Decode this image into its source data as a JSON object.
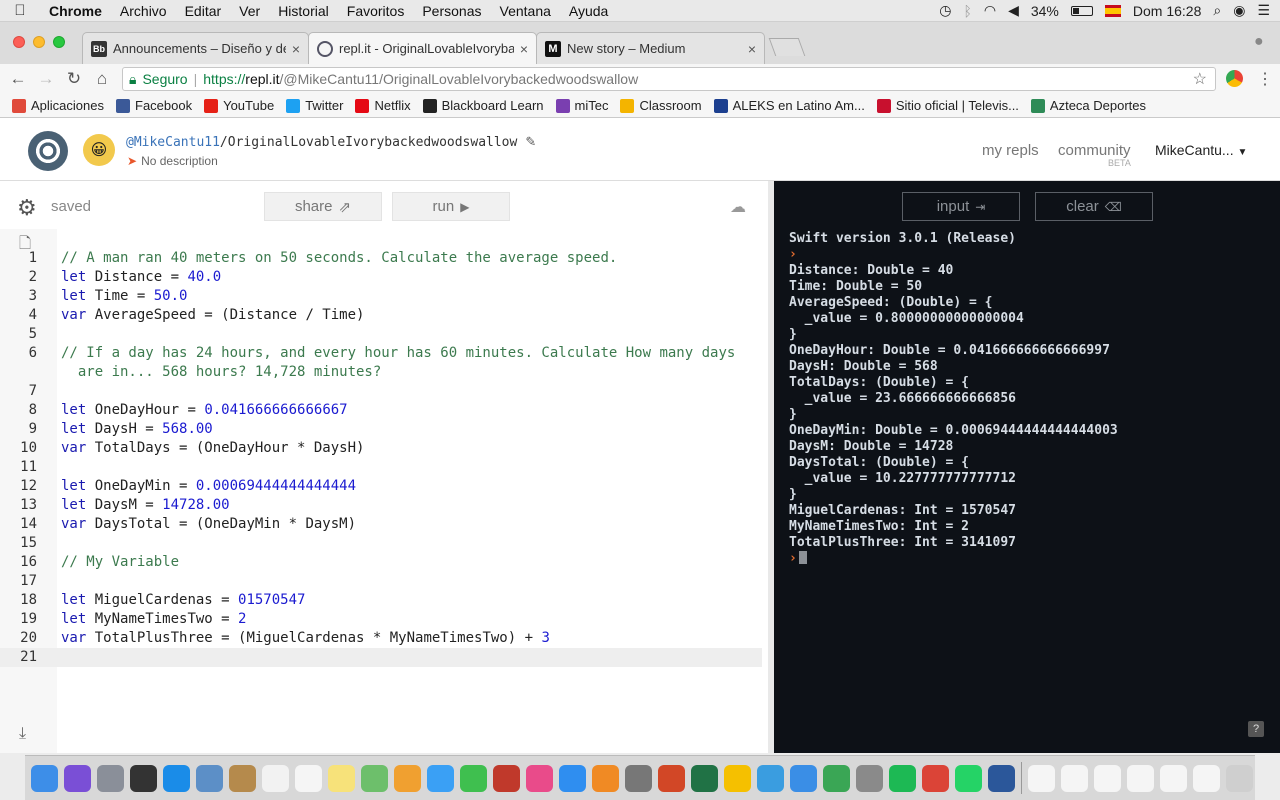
{
  "menubar": {
    "apple": "",
    "app": "Chrome",
    "items": [
      "Archivo",
      "Editar",
      "Ver",
      "Historial",
      "Favoritos",
      "Personas",
      "Ventana",
      "Ayuda"
    ],
    "battery": "34%",
    "clock": "Dom 16:28"
  },
  "tabs": [
    {
      "favicon": "Bb",
      "title": "Announcements – Diseño y de",
      "close": "×"
    },
    {
      "favicon": "",
      "title": "repl.it - OriginalLovableIvoryba",
      "close": "×"
    },
    {
      "favicon": "M",
      "title": "New story – Medium",
      "close": "×"
    }
  ],
  "address": {
    "secure_label": "Seguro",
    "scheme": "https://",
    "host": "repl.it",
    "path": "/@MikeCantu11/OriginalLovableIvorybackedwoodswallow"
  },
  "bookmarks": [
    {
      "label": "Aplicaciones",
      "icon": "apps-grid-icon",
      "color": "#e04a3b"
    },
    {
      "label": "Facebook",
      "icon": "facebook-icon",
      "color": "#3b5998"
    },
    {
      "label": "YouTube",
      "icon": "youtube-icon",
      "color": "#e62117"
    },
    {
      "label": "Twitter",
      "icon": "twitter-icon",
      "color": "#1da1f2"
    },
    {
      "label": "Netflix",
      "icon": "netflix-icon",
      "color": "#e50914"
    },
    {
      "label": "Blackboard Learn",
      "icon": "blackboard-icon",
      "color": "#222222"
    },
    {
      "label": "miTec",
      "icon": "mitec-icon",
      "color": "#7a3fb0"
    },
    {
      "label": "Classroom",
      "icon": "classroom-icon",
      "color": "#f4b400"
    },
    {
      "label": "ALEKS en Latino Am...",
      "icon": "aleks-icon",
      "color": "#1c3f8f"
    },
    {
      "label": "Sitio oficial | Televis...",
      "icon": "televisa-icon",
      "color": "#c8102e"
    },
    {
      "label": "Azteca Deportes",
      "icon": "azteca-icon",
      "color": "#2e8b57"
    }
  ],
  "repl": {
    "user": "@MikeCantu11",
    "name": "/OriginalLovableIvorybackedwoodswallow",
    "description": "No description",
    "nav": {
      "my_repls": "my repls",
      "community": "community",
      "beta": "BETA",
      "user_menu": "MikeCantu..."
    }
  },
  "editor": {
    "status": "saved",
    "share_label": "share",
    "run_label": "run",
    "lines": [
      {
        "n": "1",
        "kind": "comment",
        "text": "// A man ran 40 meters on 50 seconds. Calculate the average speed."
      },
      {
        "n": "2",
        "kind": "decl",
        "kw": "let",
        "name": " Distance = ",
        "value": "40.0"
      },
      {
        "n": "3",
        "kind": "decl",
        "kw": "let",
        "name": " Time = ",
        "value": "50.0"
      },
      {
        "n": "4",
        "kind": "decl",
        "kw": "var",
        "name": " AverageSpeed = (Distance / Time)",
        "value": ""
      },
      {
        "n": "5",
        "kind": "blank",
        "text": ""
      },
      {
        "n": "6",
        "kind": "comment",
        "text": "// If a day has 24 hours, and every hour has 60 minutes. Calculate How many days\n  are in... 568 hours? 14,728 minutes?"
      },
      {
        "n": "7",
        "kind": "blank",
        "text": ""
      },
      {
        "n": "8",
        "kind": "decl",
        "kw": "let",
        "name": " OneDayHour = ",
        "value": "0.041666666666667"
      },
      {
        "n": "9",
        "kind": "decl",
        "kw": "let",
        "name": " DaysH = ",
        "value": "568.00"
      },
      {
        "n": "10",
        "kind": "decl",
        "kw": "var",
        "name": " TotalDays = (OneDayHour * DaysH)",
        "value": ""
      },
      {
        "n": "11",
        "kind": "blank",
        "text": ""
      },
      {
        "n": "12",
        "kind": "decl",
        "kw": "let",
        "name": " OneDayMin = ",
        "value": "0.00069444444444444"
      },
      {
        "n": "13",
        "kind": "decl",
        "kw": "let",
        "name": " DaysM = ",
        "value": "14728.00"
      },
      {
        "n": "14",
        "kind": "decl",
        "kw": "var",
        "name": " DaysTotal = (OneDayMin * DaysM)",
        "value": ""
      },
      {
        "n": "15",
        "kind": "blank",
        "text": ""
      },
      {
        "n": "16",
        "kind": "comment",
        "text": "// My Variable"
      },
      {
        "n": "17",
        "kind": "blank",
        "text": ""
      },
      {
        "n": "18",
        "kind": "decl",
        "kw": "let",
        "name": " MiguelCardenas = ",
        "value": "01570547"
      },
      {
        "n": "19",
        "kind": "decl",
        "kw": "let",
        "name": " MyNameTimesTwo = ",
        "value": "2"
      },
      {
        "n": "20",
        "kind": "decl",
        "kw": "var",
        "name": " TotalPlusThree = (MiguelCardenas * MyNameTimesTwo) + ",
        "value": "3"
      },
      {
        "n": "21",
        "kind": "blank",
        "text": ""
      }
    ]
  },
  "console": {
    "input_label": "input",
    "clear_label": "clear",
    "version": "Swift version 3.0.1 (Release)",
    "output": "Distance: Double = 40\nTime: Double = 50\nAverageSpeed: (Double) = {\n  _value = 0.80000000000000004\n}\nOneDayHour: Double = 0.041666666666666997\nDaysH: Double = 568\nTotalDays: (Double) = {\n  _value = 23.666666666666856\n}\nOneDayMin: Double = 0.00069444444444444003\nDaysM: Double = 14728\nDaysTotal: (Double) = {\n  _value = 10.227777777777712\n}\nMiguelCardenas: Int = 1570547\nMyNameTimesTwo: Int = 2\nTotalPlusThree: Int = 3141097",
    "prompt": "›",
    "help": "?"
  },
  "dock": [
    {
      "icon": "finder-icon",
      "color": "#3d8ee8"
    },
    {
      "icon": "siri-icon",
      "color": "#7a4fd6"
    },
    {
      "icon": "launchpad-icon",
      "color": "#8a8f99"
    },
    {
      "icon": "mission-control-icon",
      "color": "#333333"
    },
    {
      "icon": "safari-icon",
      "color": "#1a8ce8"
    },
    {
      "icon": "preview-icon",
      "color": "#5c8fc7"
    },
    {
      "icon": "notes-book-icon",
      "color": "#b58a4c"
    },
    {
      "icon": "calendar-icon",
      "color": "#f2f2f2"
    },
    {
      "icon": "reminders-icon",
      "color": "#f5f5f5"
    },
    {
      "icon": "stickies-icon",
      "color": "#f7e27a"
    },
    {
      "icon": "maps-icon",
      "color": "#6dbf6b"
    },
    {
      "icon": "photos-icon",
      "color": "#f0a030"
    },
    {
      "icon": "messages-icon",
      "color": "#3aa0f5"
    },
    {
      "icon": "facetime-icon",
      "color": "#3fbf4f"
    },
    {
      "icon": "photo-booth-icon",
      "color": "#c0392b"
    },
    {
      "icon": "itunes-icon",
      "color": "#e94b8a"
    },
    {
      "icon": "app-store-icon",
      "color": "#2f8ef0"
    },
    {
      "icon": "ibooks-icon",
      "color": "#f08a24"
    },
    {
      "icon": "system-preferences-icon",
      "color": "#777777"
    },
    {
      "icon": "powerpoint-icon",
      "color": "#d24726"
    },
    {
      "icon": "excel-icon",
      "color": "#207245"
    },
    {
      "icon": "onenote-icon",
      "color": "#f5c000"
    },
    {
      "icon": "codeblocks-icon",
      "color": "#3a9de0"
    },
    {
      "icon": "keynote-icon",
      "color": "#3a8ee6"
    },
    {
      "icon": "numbers-icon",
      "color": "#3aa655"
    },
    {
      "icon": "pages-icon",
      "color": "#8a8a8a"
    },
    {
      "icon": "spotify-icon",
      "color": "#1db954"
    },
    {
      "icon": "chrome-icon",
      "color": "#db4437"
    },
    {
      "icon": "whatsapp-icon",
      "color": "#25d366"
    },
    {
      "icon": "word-icon",
      "color": "#2b579a"
    },
    {
      "icon": "separator",
      "color": ""
    },
    {
      "icon": "window-thumbnail-icon",
      "color": "#f5f5f5"
    },
    {
      "icon": "window-thumbnail-icon",
      "color": "#f5f5f5"
    },
    {
      "icon": "window-thumbnail-icon",
      "color": "#f5f5f5"
    },
    {
      "icon": "window-thumbnail-icon",
      "color": "#f5f5f5"
    },
    {
      "icon": "window-thumbnail-icon",
      "color": "#f5f5f5"
    },
    {
      "icon": "window-thumbnail-icon",
      "color": "#f5f5f5"
    },
    {
      "icon": "trash-icon",
      "color": "#cfcfcf"
    }
  ]
}
